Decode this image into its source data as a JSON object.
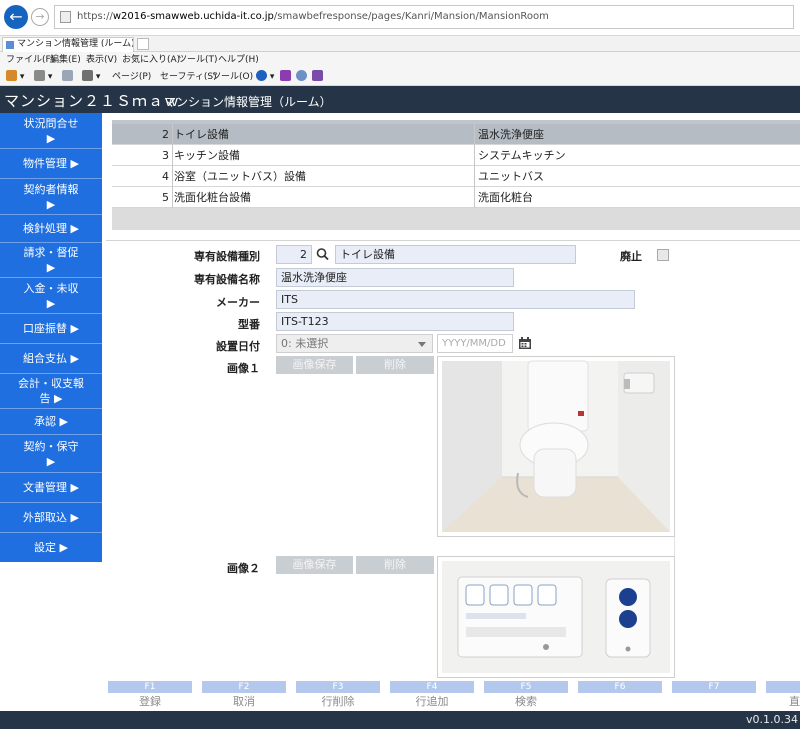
{
  "browser": {
    "url_prefix": "https://",
    "url_host": "w2016-smawweb.uchida-it.co.jp",
    "url_path": "/smawbefresponse/pages/Kanri/Mansion/MansionRoom",
    "tab_title": "マンション情報管理 (ルーム) ...",
    "menus": [
      "ファイル(F)",
      "編集(E)",
      "表示(V)",
      "お気に入り(A)",
      "ツール(T)",
      "ヘルプ(H)"
    ],
    "commands": [
      "ページ(P)",
      "セーフティ(S)",
      "ツール(O)"
    ]
  },
  "app": {
    "title": "マンション２１Ｓｍａｗ",
    "subtitle": "マンション情報管理（ルーム）"
  },
  "sidebar": {
    "items": [
      {
        "label": "状況問合せ ▶"
      },
      {
        "label": "物件管理 ▶"
      },
      {
        "label": "契約者情報 ▶"
      },
      {
        "label": "検針処理 ▶"
      },
      {
        "label": "請求・督促 ▶"
      },
      {
        "label": "入金・未収 ▶"
      },
      {
        "label": "口座振替 ▶"
      },
      {
        "label": "組合支払 ▶"
      },
      {
        "label": "会計・収支報告 ▶"
      },
      {
        "label": "承認 ▶"
      },
      {
        "label": "契約・保守 ▶"
      },
      {
        "label": "文書管理 ▶"
      },
      {
        "label": "外部取込 ▶"
      },
      {
        "label": "設定 ▶"
      }
    ]
  },
  "equipment_table": {
    "rows": [
      {
        "no": "2",
        "name": "トイレ設備",
        "value": "温水洗浄便座"
      },
      {
        "no": "3",
        "name": "キッチン設備",
        "value": "システムキッチン"
      },
      {
        "no": "4",
        "name": "浴室（ユニットバス）設備",
        "value": "ユニットバス"
      },
      {
        "no": "5",
        "name": "洗面化粧台設備",
        "value": "洗面化粧台"
      }
    ]
  },
  "form": {
    "type_label": "専有設備種別",
    "type_code": "2",
    "type_name": "トイレ設備",
    "abolish_label": "廃止",
    "name_label": "専有設備名称",
    "name_value": "温水洗浄便座",
    "maker_label": "メーカー",
    "maker_value": "ITS",
    "model_label": "型番",
    "model_value": "ITS-T123",
    "install_label": "設置日付",
    "install_select": "0: 未選択",
    "date_placeholder": "YYYY/MM/DD",
    "image1_label": "画像１",
    "image2_label": "画像２",
    "save_image_label": "画像保存",
    "delete_label": "削除"
  },
  "fkeys": [
    {
      "key": "F1",
      "label": "登録"
    },
    {
      "key": "F2",
      "label": "取消"
    },
    {
      "key": "F3",
      "label": "行削除"
    },
    {
      "key": "F4",
      "label": "行追加"
    },
    {
      "key": "F5",
      "label": "検索"
    },
    {
      "key": "F6",
      "label": ""
    },
    {
      "key": "F7",
      "label": ""
    },
    {
      "key": "",
      "label": "直"
    }
  ],
  "status": {
    "version": "v0.1.0.34"
  },
  "colors": {
    "sidebar": "#1f6fe0",
    "header": "#253547",
    "field_bg": "#e8edf7",
    "fkey_bg": "#b4c8ee"
  }
}
